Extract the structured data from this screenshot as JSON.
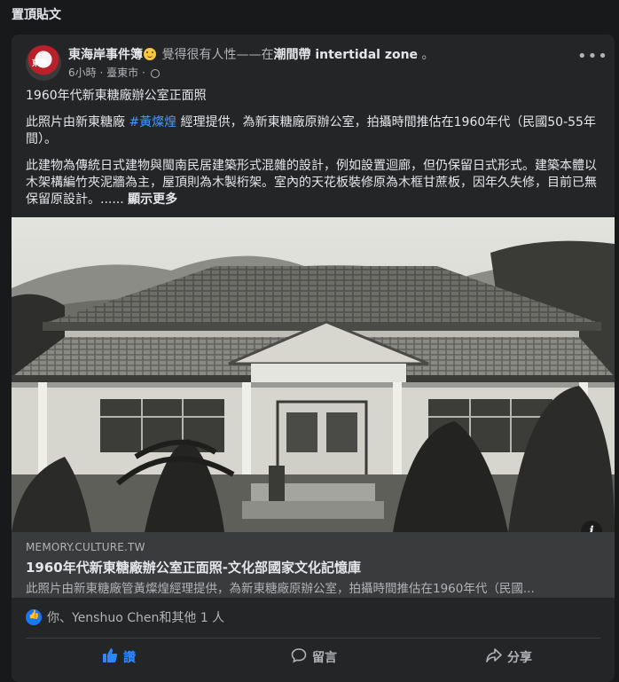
{
  "section": {
    "title": "置頂貼文"
  },
  "post": {
    "author": "東海岸事件簿",
    "feeling": "覺得很有人性——在",
    "page": "潮間帶 intertidal zone",
    "page_suffix": "。",
    "time": "6小時",
    "separator": "·",
    "location": "臺東市",
    "text": {
      "line1": "1960年代新東糖廠辦公室正面照",
      "p2_before": "此照片由新東糖廠 ",
      "p2_hashtag": "#黃燦煌",
      "p2_after": " 經理提供，為新東糖廠原辦公室，拍攝時間推估在1960年代（民國50-55年間）。",
      "p3": "此建物為傳統日式建物與閩南民居建築形式混雜的設計，例如設置迴廊，但仍保留日式形式。建築本體以木架構編竹夾泥牆為主，屋頂則為木製桁架。室內的天花板裝修原為木框甘蔗板，因年久失修，目前已無保留原設計。...... ",
      "see_more": "顯示更多"
    }
  },
  "link": {
    "domain": "MEMORY.CULTURE.TW",
    "title": "1960年代新東糖廠辦公室正面照-文化部國家文化記憶庫",
    "description": "此照片由新東糖廠管黃燦煌經理提供，為新東糖廠原辦公室，拍攝時間推估在1960年代（民國..."
  },
  "reactions": {
    "text": "你、Yenshuo Chen和其他 1 人"
  },
  "actions": {
    "like": "讚",
    "comment": "留言",
    "share": "分享"
  },
  "colors": {
    "background": "#18191a",
    "card": "#242526",
    "accent": "#2d88ff",
    "hashtag": "#4599ff"
  },
  "icons": [
    "smiley-icon",
    "globe-icon",
    "more-icon",
    "info-icon",
    "like-icon",
    "comment-icon",
    "share-icon"
  ]
}
